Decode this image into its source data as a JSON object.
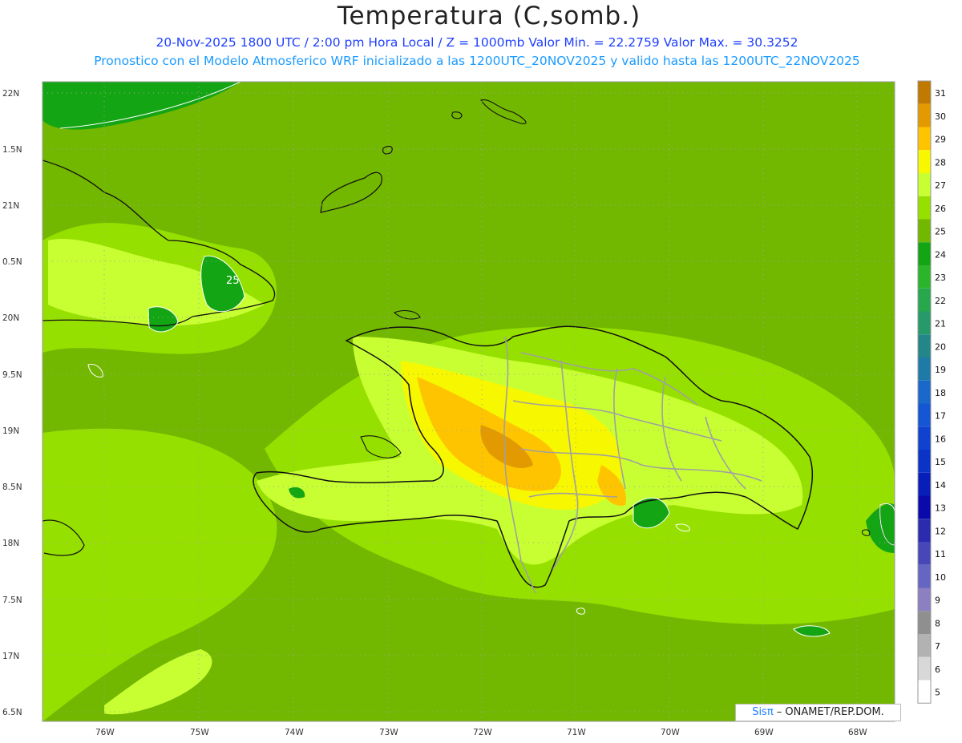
{
  "header": {
    "title": "Temperatura (C,somb.)",
    "line1": "20-Nov-2025  1800 UTC / 2:00 pm Hora Local / Z = 1000mb   Valor Min. = 22.2759  Valor Max. = 30.3252",
    "line2": "Pronostico con el Modelo Atmosferico WRF inicializado a las 1200UTC_20NOV2025 y valido hasta las  1200UTC_22NOV2025"
  },
  "axes": {
    "lat_labels": [
      "22N",
      "1.5N",
      "21N",
      "0.5N",
      "20N",
      "9.5N",
      "19N",
      "8.5N",
      "18N",
      "7.5N",
      "17N",
      "6.5N"
    ],
    "lon_labels": [
      "76W",
      "75W",
      "74W",
      "73W",
      "72W",
      "71W",
      "70W",
      "69W",
      "68W"
    ]
  },
  "contour_label": "25",
  "colorbar": {
    "labels": [
      "31",
      "30",
      "29",
      "28",
      "27",
      "26",
      "25",
      "24",
      "23",
      "22",
      "21",
      "20",
      "19",
      "18",
      "17",
      "16",
      "15",
      "14",
      "13",
      "12",
      "11",
      "10",
      "9",
      "8",
      "7",
      "6",
      "5"
    ],
    "colors": [
      "#c07a00",
      "#e29a00",
      "#ffc400",
      "#f7f700",
      "#c8ff33",
      "#96e000",
      "#73b800",
      "#14a514",
      "#2bb52b",
      "#28a84c",
      "#269a69",
      "#23878a",
      "#1f7aa8",
      "#1a68c9",
      "#1456d4",
      "#0f43cf",
      "#0b33c5",
      "#071fb8",
      "#0a0aaa",
      "#2b2bb0",
      "#4747b8",
      "#6565c2",
      "#8c7fc2",
      "#8f8f8f",
      "#b2b2b2",
      "#d8d8d8",
      "#ffffff"
    ]
  },
  "credit": {
    "brand": "Sisπ",
    "text": " – ONAMET/REP.DOM."
  },
  "colors": {
    "sea": "#73b800",
    "warm": "#96e000",
    "warmer": "#c8ff33",
    "hot": "#ffc400",
    "hottest": "#e29a00",
    "cool": "#14a514",
    "coast": "#111111",
    "borders": "#a0a0a0"
  }
}
